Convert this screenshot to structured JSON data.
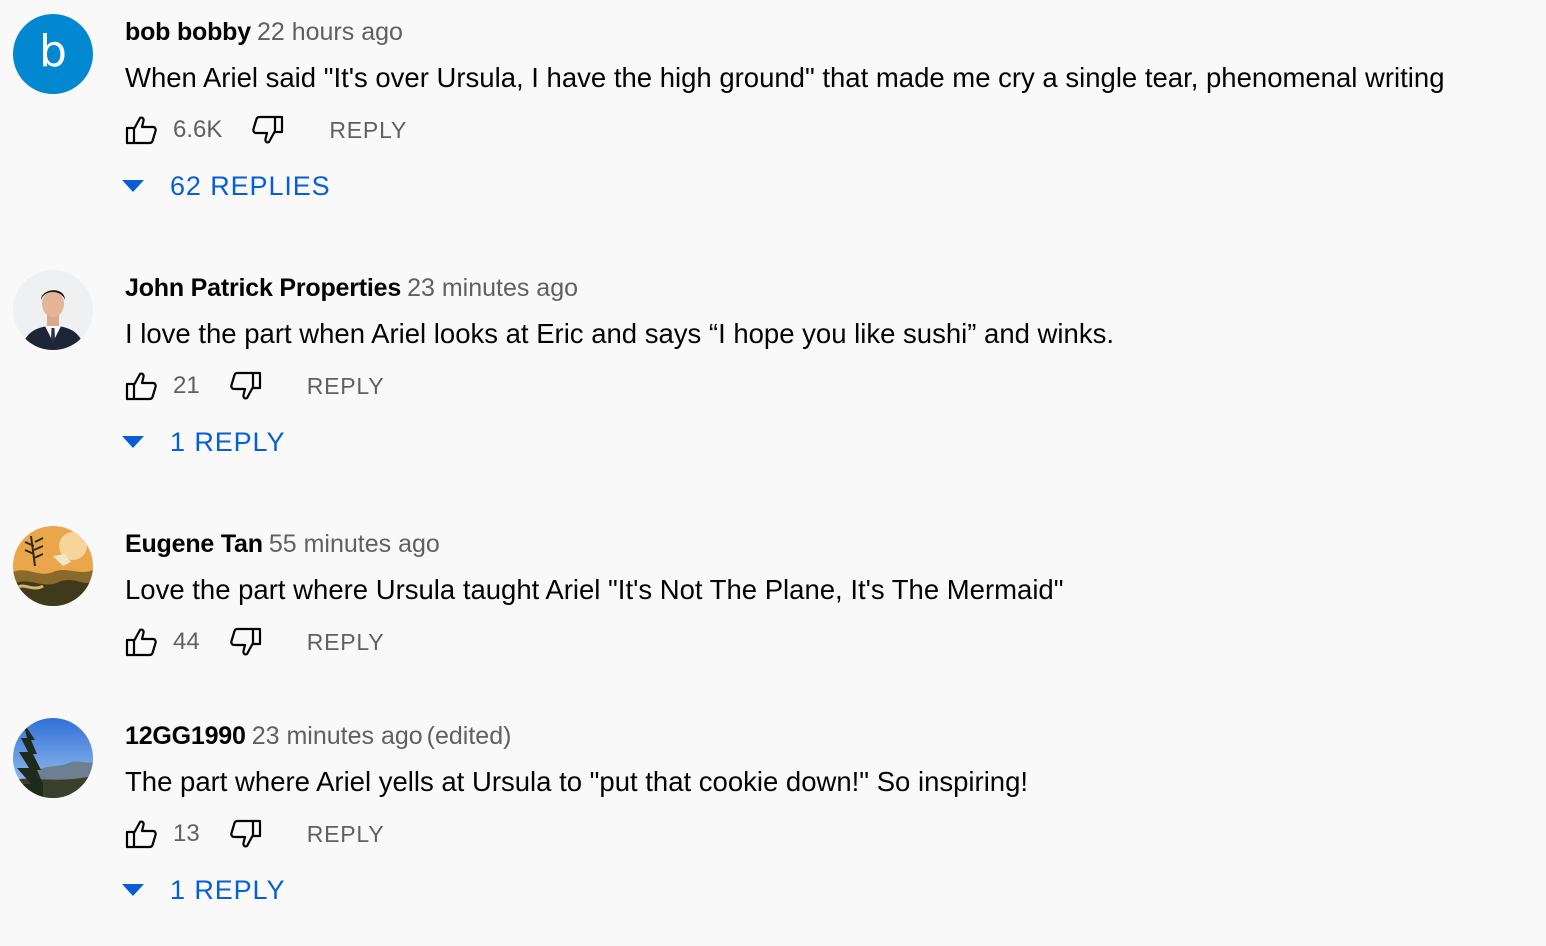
{
  "colors": {
    "background": "#f9f9f9",
    "link_blue": "#065fd4",
    "secondary_text": "#606060",
    "avatar_b": "#0288d1"
  },
  "comments": [
    {
      "author": "bob bobby",
      "time": "22 hours ago",
      "edited": "",
      "avatar_letter": "b",
      "text": "When Ariel said \"It's over Ursula, I have the high ground\" that made me cry a single tear, phenomenal writing",
      "likes": "6.6K",
      "reply_label": "REPLY",
      "replies_label": "62 REPLIES"
    },
    {
      "author": "John Patrick Properties",
      "time": "23 minutes ago",
      "edited": "",
      "avatar_letter": "",
      "text": "I love the part when Ariel looks at Eric and says “I hope you like sushi” and winks.",
      "likes": "21",
      "reply_label": "REPLY",
      "replies_label": "1 REPLY"
    },
    {
      "author": "Eugene Tan",
      "time": "55 minutes ago",
      "edited": "",
      "avatar_letter": "",
      "text": "Love the part where Ursula taught Ariel \"It's Not The Plane, It's The Mermaid\"",
      "likes": "44",
      "reply_label": "REPLY",
      "replies_label": ""
    },
    {
      "author": "12GG1990",
      "time": "23 minutes ago",
      "edited": "(edited)",
      "avatar_letter": "",
      "text": "The part where Ariel yells at Ursula to \"put that cookie down!\" So inspiring!",
      "likes": "13",
      "reply_label": "REPLY",
      "replies_label": "1 REPLY"
    }
  ],
  "icons": {
    "like": "thumbs-up-icon",
    "dislike": "thumbs-down-icon",
    "expand": "caret-down-icon"
  }
}
